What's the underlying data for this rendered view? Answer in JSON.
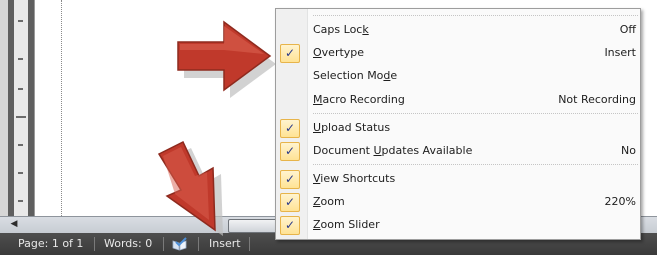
{
  "menu": {
    "items": [
      {
        "before": "Caps Loc",
        "key": "k",
        "after": "",
        "value": "Off",
        "checked": false
      },
      {
        "before": "",
        "key": "O",
        "after": "vertype",
        "value": "Insert",
        "checked": true
      },
      {
        "before": "Selection Mo",
        "key": "d",
        "after": "e",
        "value": "",
        "checked": false
      },
      {
        "before": "",
        "key": "M",
        "after": "acro Recording",
        "value": "Not Recording",
        "checked": false
      },
      {
        "before": "",
        "key": "U",
        "after": "pload Status",
        "value": "",
        "checked": true
      },
      {
        "before": "Document ",
        "key": "U",
        "after": "pdates Available",
        "value": "No",
        "checked": true
      },
      {
        "before": "",
        "key": "V",
        "after": "iew Shortcuts",
        "value": "",
        "checked": true
      },
      {
        "before": "",
        "key": "Z",
        "after": "oom",
        "value": "220%",
        "checked": true
      },
      {
        "before": "",
        "key": "Z",
        "after": "oom Slider",
        "value": "",
        "checked": true
      }
    ],
    "check_glyph": "✓"
  },
  "statusbar": {
    "page": "Page: 1 of 1",
    "words": "Words: 0",
    "mode": "Insert",
    "proofing_icon": "proofing-book-icon"
  },
  "scrollbar": {
    "left_arrow": "◀"
  },
  "colors": {
    "arrow": "#c0392b",
    "statusbar": "#404040",
    "check_bg": "#ffe394"
  }
}
